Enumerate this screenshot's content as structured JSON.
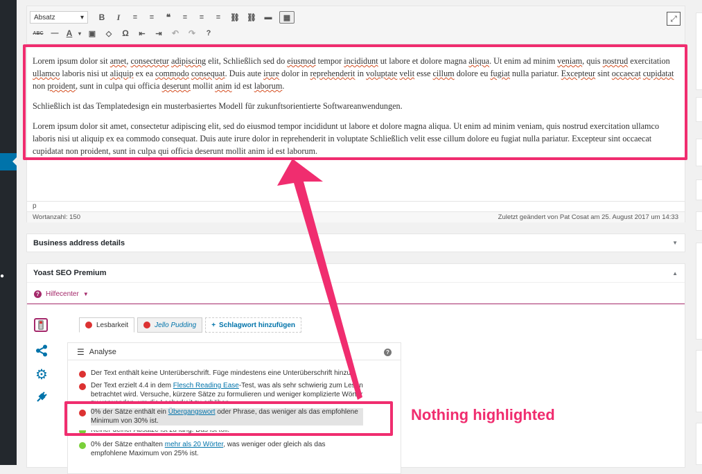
{
  "toolbar": {
    "format_select": "Absatz",
    "row1": [
      "B",
      "I",
      "≡",
      "≡",
      "❝",
      "≡",
      "≡",
      "≡",
      "⛓",
      "⛓",
      "▬",
      "▦"
    ],
    "row2": [
      "ABC",
      "—",
      "A",
      "▣",
      "◇",
      "Ω",
      "⇤",
      "⇥",
      "↶",
      "↷",
      "?"
    ],
    "fullscreen_icon": "expand-icon"
  },
  "editor": {
    "paragraph1_parts": [
      "Lorem ipsum dolor sit ",
      "amet",
      ", ",
      "consectetur",
      " ",
      "adipiscing",
      " elit, Schließlich sed do ",
      "eiusmod",
      " tempor ",
      "incididunt",
      " ut labore et dolore magna ",
      "aliqua",
      ". Ut enim ad minim ",
      "veniam",
      ", quis ",
      "nostrud",
      " exercitation ",
      "ullamco",
      " laboris nisi ut ",
      "aliquip",
      " ex ea ",
      "commodo",
      " ",
      "consequat",
      ". Duis aute ",
      "irure",
      " dolor in ",
      "reprehenderit",
      " in ",
      "voluptate",
      " ",
      "velit",
      " esse ",
      "cillum",
      " dolore eu ",
      "fugiat",
      " nulla pariatur. ",
      "Excepteur",
      " sint ",
      "occaecat",
      " ",
      "cupidatat",
      " non ",
      "proident",
      ", sunt in culpa qui officia ",
      "deserunt",
      " mollit ",
      "anim",
      " id est ",
      "laborum",
      "."
    ],
    "paragraph2": "Schließlich ist das Templatedesign ein musterbasiertes Modell für zukunftsorientierte Softwareanwendungen.",
    "paragraph3": "Lorem ipsum dolor sit amet, consectetur adipiscing elit, sed do eiusmod tempor incididunt ut labore et dolore magna aliqua. Ut enim ad minim veniam, quis nostrud exercitation ullamco laboris nisi ut aliquip ex ea commodo consequat. Duis aute irure dolor in reprehenderit in voluptate Schließlich velit esse cillum dolore eu fugiat nulla pariatur. Excepteur sint occaecat cupidatat non proident, sunt in culpa qui officia deserunt mollit anim id est laborum.",
    "path": "p",
    "word_count": "Wortanzahl: 150",
    "last_modified": "Zuletzt geändert von Pat Cosat am 25. August 2017 um 14:33"
  },
  "business": {
    "title": "Business address details"
  },
  "yoast": {
    "title": "Yoast SEO Premium",
    "help_center": "Hilfecenter",
    "tabs": [
      "Lesbarkeit",
      "Jello Pudding",
      "Schlagwort hinzufügen"
    ],
    "analysis_title": "Analyse",
    "results": [
      {
        "status": "bad",
        "text": "Der Text enthält keine Unterüberschrift. Füge mindestens eine Unterüberschrift hinzu."
      },
      {
        "status": "bad",
        "pre": "Der Text erzielt 4.4 in dem ",
        "link": "Flesch Reading Ease",
        "post": "-Test, was als sehr schwierig zum Lesen betrachtet wird. Versuche, kürzere Sätze zu formulieren und weniger komplizierte Wörter zu verwenden, um die Lesbarkeit zu erhöhen."
      },
      {
        "status": "bad",
        "pre": "0% der Sätze enthält ein ",
        "link": "Übergangswort",
        "post": " oder Phrase, das weniger als das empfohlene Minimum von 30% ist."
      },
      {
        "status": "good",
        "text": "Keiner deiner Absätze ist zu lang. Das ist toll."
      },
      {
        "status": "good",
        "pre": "0% der Sätze enthalten ",
        "link": "mehr als 20 Wörter",
        "post": ", was weniger oder gleich als das empfohlene Maximum von 25% ist."
      }
    ]
  },
  "annotation": {
    "label": "Nothing highlighted",
    "color": "#f02d6f"
  }
}
